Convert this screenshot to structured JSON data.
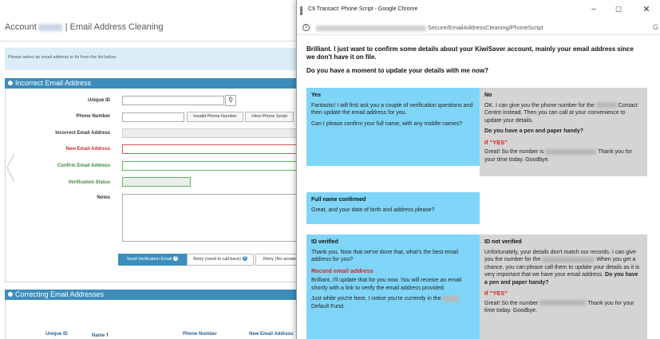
{
  "app": {
    "account_label": "Account",
    "page_title": "| Email Address Cleaning",
    "instruction": "Please select an email address to fix from the list below.",
    "incorrect_panel_title": "Incorrect Email Address",
    "fields": {
      "unique_id": "Unique ID",
      "phone_number": "Phone Number",
      "incorrect_email": "Incorrect Email Address",
      "new_email": "New Email Address",
      "confirm_email": "Confirm Email Address",
      "verification_status": "Verification Status",
      "notes": "Notes"
    },
    "buttons": {
      "invalid_phone": "Invalid Phone Number",
      "view_script": "View Phone Script",
      "send_verification": "Send Verification Email",
      "retry_call_back": "Retry (need to call back)",
      "retry_no_answer": "Retry (No answe"
    },
    "correcting_panel_title": "Correcting Email Addresses",
    "table_headers": {
      "unique_id": "Unique ID",
      "name": "Name",
      "phone_number": "Phone Number",
      "new_email": "New Email Address"
    },
    "colors": {
      "accent": "#3c8dbc",
      "error": "#c9302c",
      "success": "#3c8a3c"
    }
  },
  "popup": {
    "window_title": "C9 Transact: Phone Script - Google Chrome",
    "url_suffix": "Secure/EmailAddressCleaning/PhoneScript",
    "intro_line": "Brilliant. I just want to confirm some details about your KiwiSaver account, mainly your email address since we don't have it on file.",
    "question": "Do you have a moment to update your details with me now?",
    "yes_card": {
      "heading": "Yes",
      "p1": "Fantastic! I will first ask you a couple of verification questions and then update the email address for you.",
      "p2": "Can I please confirm your full name, with any middle names?"
    },
    "no_card": {
      "heading": "No",
      "p1_a": "OK. I can give you the phone number for the",
      "p1_b": "Contact Centre instead. Then you can call at your convenience to update your details.",
      "q": "Do you have a pen and paper handy?",
      "if_yes": "If \"YES\"",
      "p2_a": "Great! So the number is",
      "p2_b": "Thank you for your time today. Goodbye."
    },
    "name_card": {
      "heading": "Full name confirmed",
      "p1": "Great, and your date of birth and address please?"
    },
    "verified_card": {
      "heading": "ID verified",
      "p1": "Thank you. Now that we've done that, what's the best email address for you?",
      "record": "Record email address",
      "p2": "Brilliant, I'll update that for you now. You will receive an email shortly with a link to verify the email address provided.",
      "p3_a": "Just while you're here, I notice you're currently in the",
      "p3_b": "Default Fund."
    },
    "not_verified_card": {
      "heading": "ID not verified",
      "p1_a": "Unfortunately, your details don't match our records. I can give you the number for the",
      "p1_b": "When you get a chance, you can please call them to update your details as it is very important that we have your email address.",
      "q": "Do you have a pen and paper handy?",
      "if_yes": "If \"YES\"",
      "p2_a": "Great! So the number",
      "p2_b": "Thank you for your time today. Goodbye."
    },
    "colors": {
      "yes_card": "#7fd5f7",
      "no_card": "#d4d4d4",
      "if_yes": "#d9241b"
    }
  }
}
